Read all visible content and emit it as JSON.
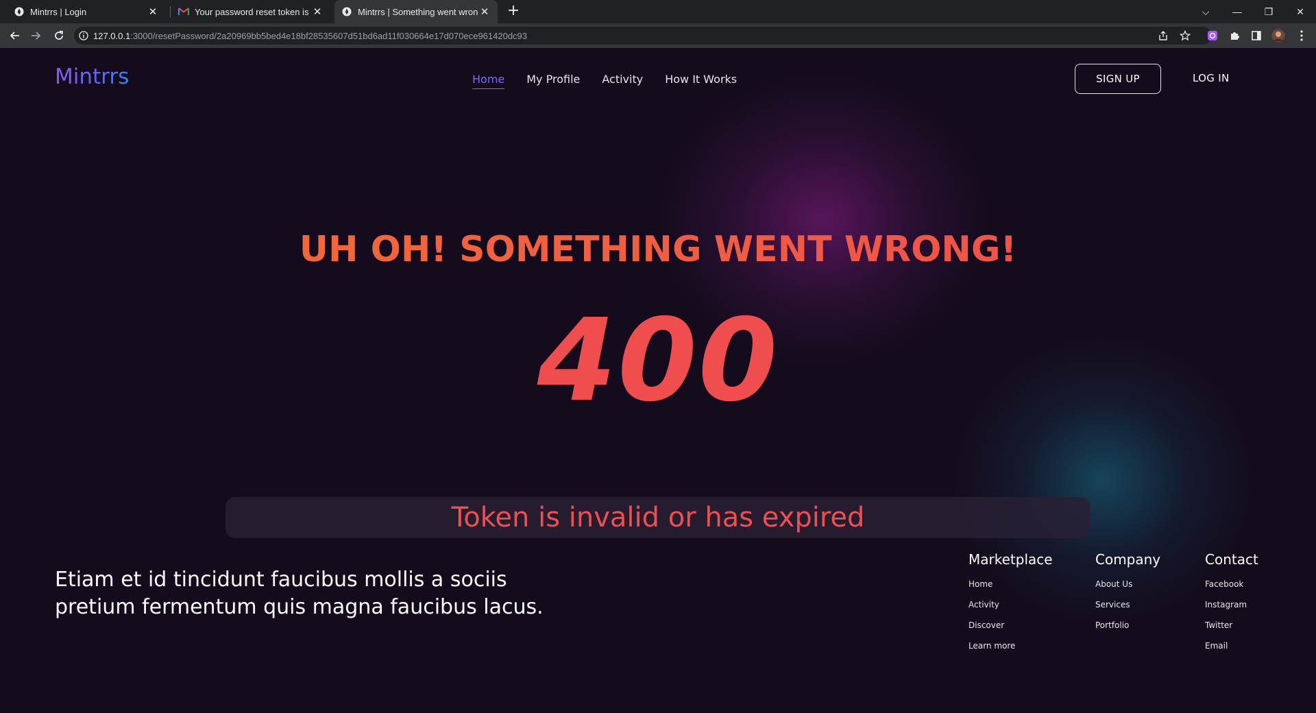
{
  "browser": {
    "tabs": [
      {
        "title": "Mintrrs | Login",
        "favicon": "mintrrs-logo-icon"
      },
      {
        "title": "Your password reset token is valid",
        "favicon": "gmail-icon"
      },
      {
        "title": "Mintrrs | Something went wrong",
        "favicon": "mintrrs-logo-icon"
      }
    ],
    "url_host": "127.0.0.1",
    "url_path": ":3000/resetPassword/2a20969bb5bed4e18bf28535607d51bd6ad11f030664e17d070ece961420dc93"
  },
  "site": {
    "logo": "Mintrrs",
    "nav": [
      "Home",
      "My Profile",
      "Activity",
      "How It Works"
    ],
    "active_nav": "Home",
    "signup_label": "SIGN UP",
    "login_label": "LOG IN"
  },
  "error": {
    "title": "UH OH! SOMETHING WENT WRONG!",
    "code": "400",
    "message": "Token is invalid or has expired"
  },
  "footer": {
    "blurb": "Etiam et id tincidunt faucibus mollis a sociis pretium fermentum quis magna faucibus lacus.",
    "columns": [
      {
        "title": "Marketplace",
        "links": [
          "Home",
          "Activity",
          "Discover",
          "Learn more"
        ]
      },
      {
        "title": "Company",
        "links": [
          "About Us",
          "Services",
          "Portfolio"
        ]
      },
      {
        "title": "Contact",
        "links": [
          "Facebook",
          "Instagram",
          "Twitter",
          "Email"
        ]
      }
    ]
  },
  "colors": {
    "background": "#140c1c",
    "accent_nav": "#7c6cf0",
    "error_red": "#f04e4e",
    "title_orange": "#f26f32"
  }
}
